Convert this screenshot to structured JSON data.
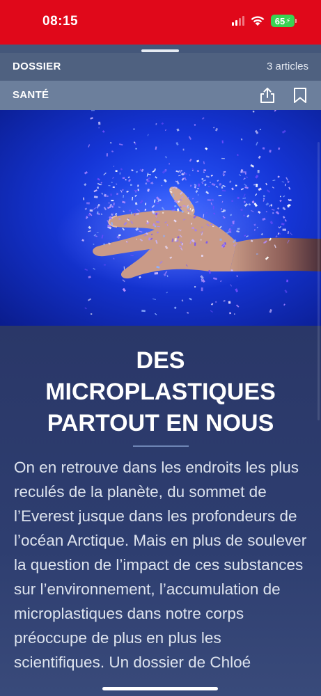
{
  "status_bar": {
    "time": "08:15",
    "battery": "65",
    "colors": {
      "background": "#e0081a",
      "battery": "#39d353"
    },
    "icons": [
      "cellular-signal-icon",
      "wifi-icon",
      "battery-icon"
    ]
  },
  "sheet": {
    "dossier_label": "DOSSIER",
    "articles_count": "3 articles",
    "section_label": "SANTÉ",
    "icons": [
      "share-icon",
      "bookmark-icon"
    ]
  },
  "hero": {
    "alt": "hand-with-glitter-microplastics-icon"
  },
  "article": {
    "headline_lines": [
      "DES",
      "MICROPLASTIQUES",
      "PARTOUT EN NOUS"
    ],
    "lede": "On en retrouve dans les endroits les plus reculés de la planète, du sommet de l’Everest jusque dans les profondeurs de l’océan Arctique. Mais en plus de soulever la question de l’impact de ces substances sur l’environnement, l’accumulation de microplastiques dans notre corps préoccupe de plus en plus les scientifiques. Un dossier de Chloé"
  }
}
